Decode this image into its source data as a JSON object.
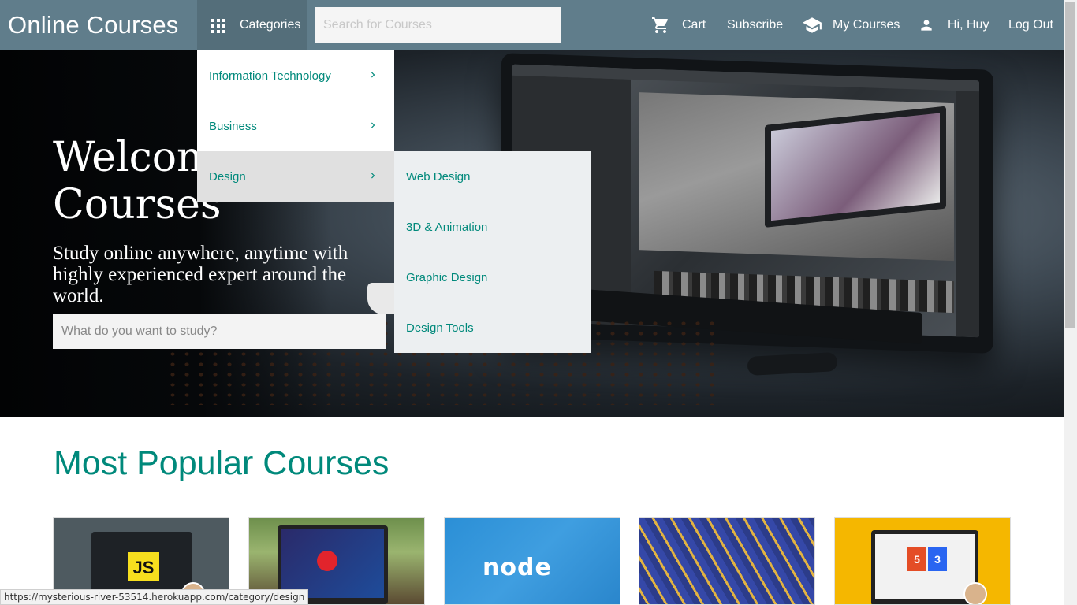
{
  "brand": "Online Courses",
  "nav": {
    "categories_label": "Categories",
    "search_placeholder": "Search for Courses",
    "cart_label": "Cart",
    "subscribe_label": "Subscribe",
    "my_courses_label": "My Courses",
    "user_greeting": "Hi, Huy",
    "logout_label": "Log Out"
  },
  "categories_menu": {
    "items": [
      {
        "label": "Information Technology"
      },
      {
        "label": "Business"
      },
      {
        "label": "Design"
      }
    ],
    "active": "Design",
    "submenu": [
      {
        "label": "Web Design"
      },
      {
        "label": "3D & Animation"
      },
      {
        "label": "Graphic Design"
      },
      {
        "label": "Design Tools"
      }
    ]
  },
  "hero": {
    "title_line1": "Welcome",
    "title_line2": "Courses",
    "subtitle": "Study online anywhere, anytime with highly experienced expert around the world.",
    "search_placeholder": "What do you want to study?"
  },
  "popular": {
    "title": "Most Popular Courses",
    "cards": [
      {
        "thumb_text": "JS",
        "icon": "javascript-logo"
      },
      {
        "thumb_text": "",
        "icon": "java-duke-laptop"
      },
      {
        "thumb_text": "node",
        "icon": "nodejs-logo"
      },
      {
        "thumb_text": "",
        "icon": "network-cables"
      },
      {
        "thumb_text": "",
        "icon": "html5-css3-logo"
      }
    ]
  },
  "status_url": "https://mysterious-river-53514.herokuapp.com/category/design",
  "colors": {
    "navbar": "#607d8b",
    "categories_bg": "#546e7a",
    "accent_teal": "#00897b",
    "submenu_bg": "#eceff1",
    "active_item_bg": "#e0e0e0"
  }
}
